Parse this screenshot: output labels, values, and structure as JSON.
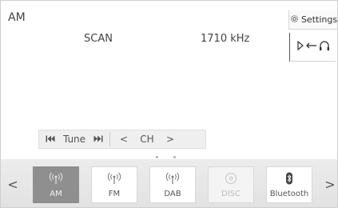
{
  "header": {
    "source": "AM"
  },
  "status": {
    "mode": "SCAN",
    "frequency": "1710 kHz"
  },
  "settings": {
    "label": "Settings",
    "icon": "gear-icon"
  },
  "output": {
    "icon": "audio-output-icon"
  },
  "controls": {
    "tune_label": "Tune",
    "ch_label": "CH",
    "tune_prev_icon": "skip-back-icon",
    "tune_next_icon": "skip-forward-icon",
    "ch_prev_symbol": "<",
    "ch_next_symbol": ">"
  },
  "pagination": {
    "pages": 3,
    "active": 1
  },
  "sources": {
    "prev_symbol": "<",
    "next_symbol": ">",
    "items": [
      {
        "label": "AM",
        "icon": "radio-antenna-icon",
        "state": "selected"
      },
      {
        "label": "FM",
        "icon": "radio-antenna-icon",
        "state": "normal"
      },
      {
        "label": "DAB",
        "icon": "radio-antenna-icon",
        "state": "normal"
      },
      {
        "label": "DISC",
        "icon": "disc-icon",
        "state": "disabled"
      },
      {
        "label": "Bluetooth",
        "icon": "bluetooth-icon",
        "state": "normal"
      }
    ]
  },
  "colors": {
    "selected_bg": "#8f8f8f",
    "tray_bg": "#e6e6e6",
    "text": "#444444"
  }
}
